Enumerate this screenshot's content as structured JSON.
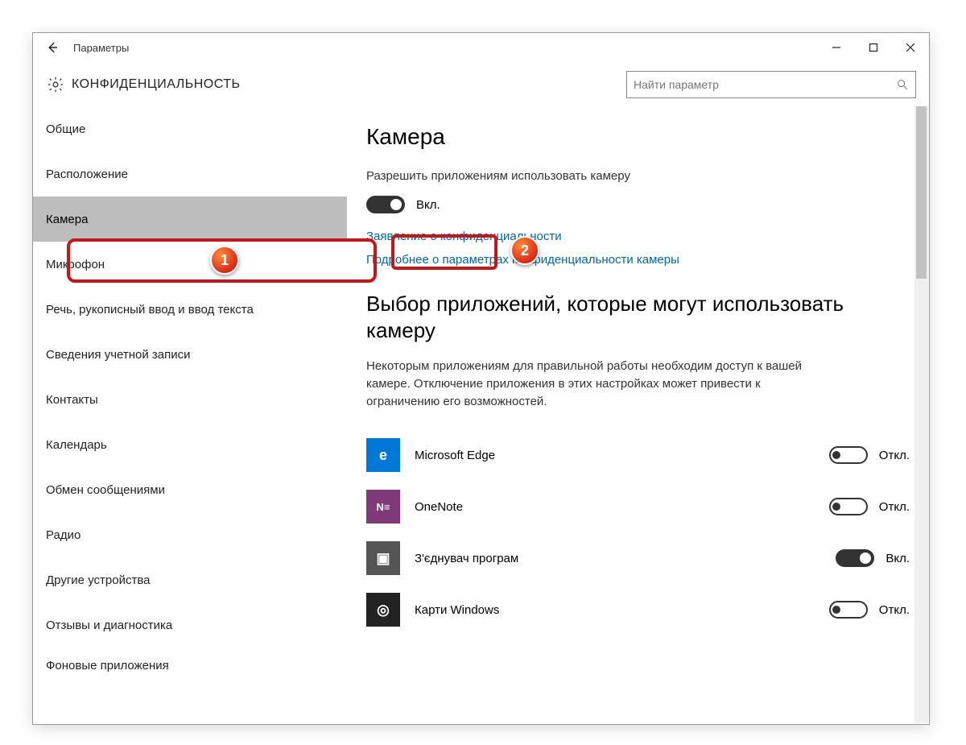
{
  "window": {
    "title": "Параметры",
    "section": "КОНФИДЕНЦИАЛЬНОСТЬ"
  },
  "search": {
    "placeholder": "Найти параметр"
  },
  "sidebar": {
    "items": [
      {
        "label": "Общие"
      },
      {
        "label": "Расположение"
      },
      {
        "label": "Камера",
        "selected": true
      },
      {
        "label": "Микрофон"
      },
      {
        "label": "Речь, рукописный ввод и ввод текста"
      },
      {
        "label": "Сведения учетной записи"
      },
      {
        "label": "Контакты"
      },
      {
        "label": "Календарь"
      },
      {
        "label": "Обмен сообщениями"
      },
      {
        "label": "Радио"
      },
      {
        "label": "Другие устройства"
      },
      {
        "label": "Отзывы и диагностика"
      },
      {
        "label": "Фоновые приложения"
      }
    ]
  },
  "content": {
    "page_title": "Камера",
    "allow_label": "Разрешить приложениям использовать камеру",
    "main_toggle": {
      "state": "on",
      "text": "Вкл."
    },
    "link_privacy": "Заявление о конфиденциальности",
    "link_more": "Подробнее о параметрах конфиденциальности камеры",
    "choose_title": "Выбор приложений, которые могут использовать камеру",
    "choose_desc": "Некоторым приложениям для правильной работы необходим доступ к вашей камере. Отключение приложения в этих настройках может привести к ограничению его возможностей.",
    "apps": [
      {
        "name": "Microsoft Edge",
        "icon": "edge",
        "glyph": "e",
        "state": "off",
        "text": "Откл."
      },
      {
        "name": "OneNote",
        "icon": "onenote",
        "glyph": "N≡",
        "state": "off",
        "text": "Откл."
      },
      {
        "name": "З'єднувач програм",
        "icon": "connector",
        "glyph": "▣",
        "state": "on",
        "text": "Вкл."
      },
      {
        "name": "Карти Windows",
        "icon": "maps",
        "glyph": "◎",
        "state": "off",
        "text": "Откл."
      }
    ]
  },
  "annotations": {
    "badge1": "1",
    "badge2": "2"
  }
}
